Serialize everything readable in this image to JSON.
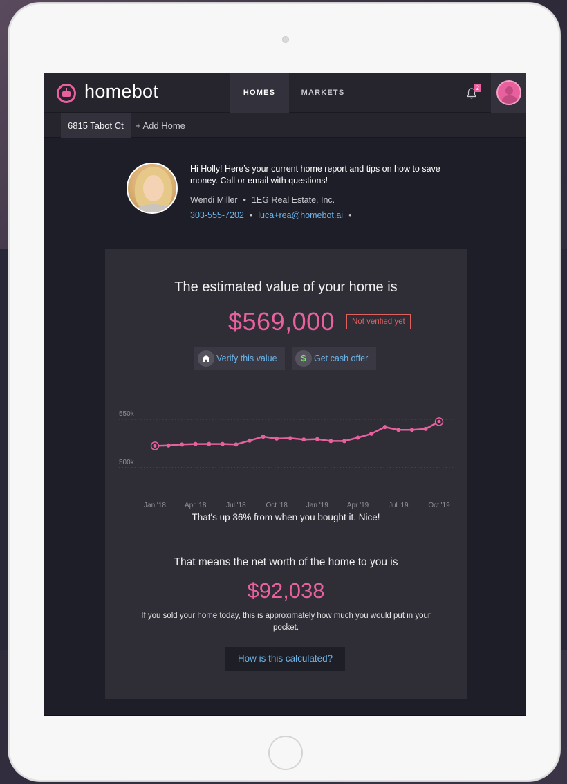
{
  "app": {
    "logo_text": "homebot",
    "tabs": [
      {
        "label": "HOMES",
        "active": true
      },
      {
        "label": "MARKETS",
        "active": false
      }
    ],
    "notification_count": "2",
    "accent_color": "#e8619e",
    "link_color": "#6cb4e8"
  },
  "subnav": {
    "active_home": "6815 Tabot Ct",
    "add_home": "+ Add Home"
  },
  "agent": {
    "message": "Hi Holly! Here’s your current home report and tips on how to save money. Call or email with questions!",
    "name": "Wendi Miller",
    "company": "1EG Real Estate, Inc.",
    "phone": "303-555-7202",
    "email": "luca+rea@homebot.ai",
    "separator": "•"
  },
  "estimate": {
    "title": "The estimated value of your home is",
    "value": "$569,000",
    "verification_status": "Not verified yet",
    "verify_button": "Verify this value",
    "cash_offer_button": "Get cash offer",
    "change_note": "That's up 36% from when you bought it. Nice!"
  },
  "net_worth": {
    "title": "That means the net worth of the home to you is",
    "value": "$92,038",
    "description": "If you sold your home today, this is approximately how much you would put in your pocket.",
    "how_button": "How is this calculated?"
  },
  "chart_data": {
    "type": "line",
    "series_color": "#e8619e",
    "y_ticks": [
      {
        "value": 500000,
        "label": "500k"
      },
      {
        "value": 550000,
        "label": "550k"
      }
    ],
    "ylim": [
      490000,
      572000
    ],
    "x_ticks": [
      {
        "index": 0,
        "label": "Jan '18"
      },
      {
        "index": 3,
        "label": "Apr '18"
      },
      {
        "index": 6,
        "label": "Jul '18"
      },
      {
        "index": 9,
        "label": "Oct '18"
      },
      {
        "index": 12,
        "label": "Jan '19"
      },
      {
        "index": 15,
        "label": "Apr '19"
      },
      {
        "index": 18,
        "label": "Jul '19"
      },
      {
        "index": 21,
        "label": "Oct '19"
      }
    ],
    "values": [
      522500,
      523000,
      524000,
      524500,
      524500,
      524500,
      524000,
      528000,
      532000,
      530000,
      530500,
      529000,
      529500,
      527500,
      527500,
      531000,
      535000,
      542000,
      539000,
      539000,
      540000,
      547500
    ],
    "highlight_first_and_last": true,
    "grid": "dotted horizontal at y ticks"
  }
}
